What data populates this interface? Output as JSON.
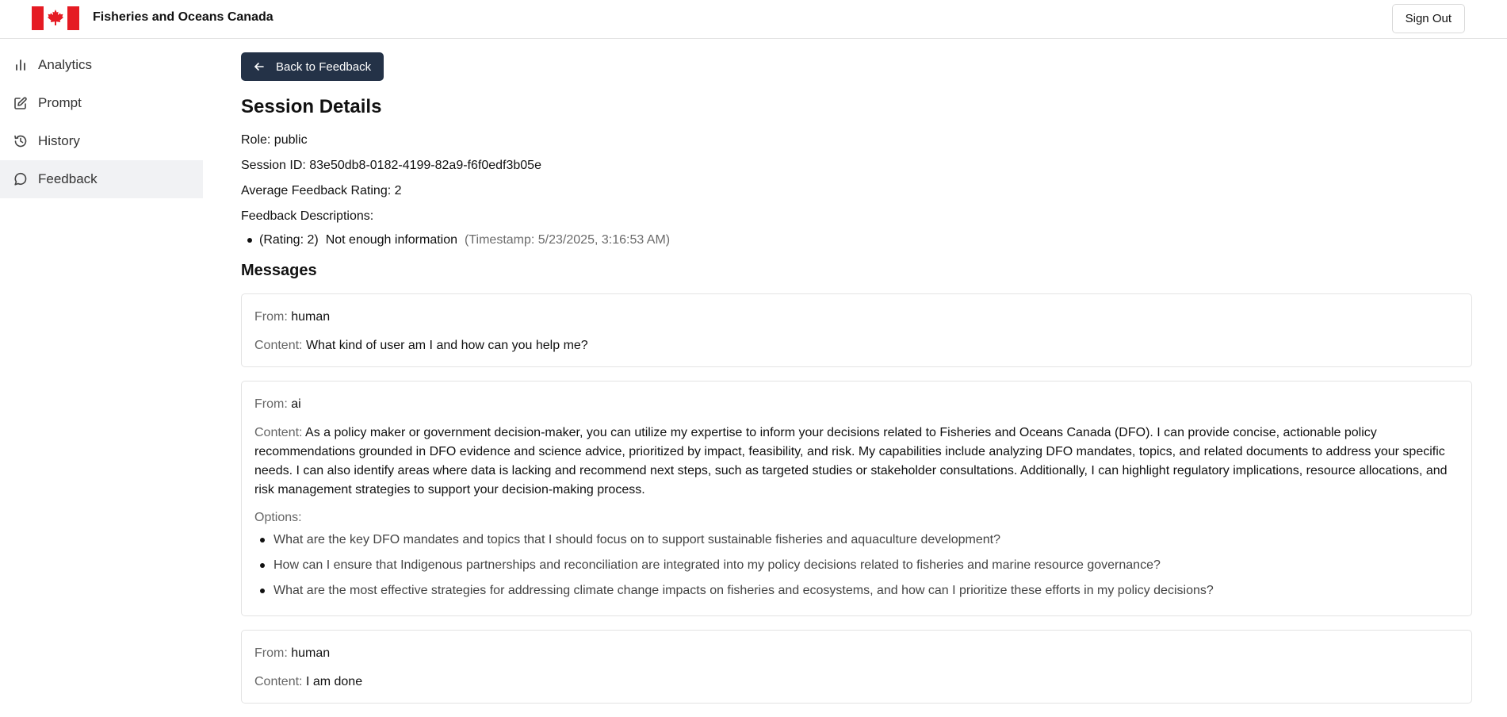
{
  "header": {
    "brand": "Fisheries and Oceans Canada",
    "sign_out": "Sign Out",
    "flag_colors": {
      "red": "#e51b23",
      "white": "#ffffff"
    }
  },
  "sidebar": {
    "items": [
      {
        "label": "Analytics",
        "icon": "bar-chart-icon"
      },
      {
        "label": "Prompt",
        "icon": "edit-icon"
      },
      {
        "label": "History",
        "icon": "history-icon"
      },
      {
        "label": "Feedback",
        "icon": "message-circle-icon",
        "active": true
      }
    ]
  },
  "main": {
    "back_label": "Back to Feedback",
    "title": "Session Details",
    "role": "Role: public",
    "session_id": "Session ID: 83e50db8-0182-4199-82a9-f6f0edf3b05e",
    "avg_rating": "Average Feedback Rating: 2",
    "feedback_heading": "Feedback Descriptions:",
    "feedback": [
      {
        "rating": "(Rating: 2)",
        "text": "Not enough information",
        "timestamp": "(Timestamp: 5/23/2025, 3:16:53 AM)"
      }
    ],
    "messages_heading": "Messages",
    "from_label": "From:",
    "content_label": "Content:",
    "options_label": "Options:",
    "messages": [
      {
        "from": "human",
        "content": "What kind of user am I and how can you help me?"
      },
      {
        "from": "ai",
        "content_lines": [
          "As a policy maker or government decision-maker, you can utilize my expertise to inform your decisions related to Fisheries and Oceans Canada (DFO). I can provide concise, actionable policy",
          "recommendations grounded in DFO evidence and science advice, prioritized by impact, feasibility, and risk. My capabilities include analyzing DFO mandates, topics, and related documents to address your specific",
          "needs. I can also identify areas where data is lacking and recommend next steps, such as targeted studies or stakeholder consultations. Additionally, I can highlight regulatory implications, resource allocations, and",
          "risk management strategies to support your decision-making process."
        ],
        "options": [
          "What are the key DFO mandates and topics that I should focus on to support sustainable fisheries and aquaculture development?",
          "How can I ensure that Indigenous partnerships and reconciliation are integrated into my policy decisions related to fisheries and marine resource governance?",
          "What are the most effective strategies for addressing climate change impacts on fisheries and ecosystems, and how can I prioritize these efforts in my policy decisions?"
        ]
      },
      {
        "from": "human",
        "content": "I am done"
      }
    ]
  }
}
